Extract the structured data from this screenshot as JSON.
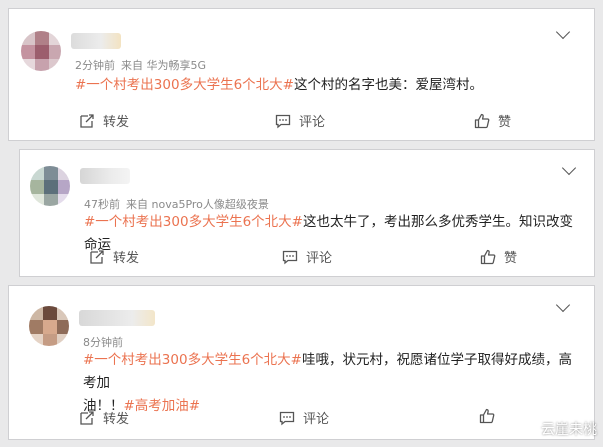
{
  "posts": [
    {
      "time": "2分钟前",
      "source": "来自 华为畅享5G",
      "topic": "#一个村考出300多大学生6个北大#",
      "text": "这个村的名字也美：爱屋湾村。",
      "text2": "",
      "topic2": "",
      "repost_label": "转发",
      "comment_label": "评论",
      "like_label": "赞"
    },
    {
      "time": "47秒前",
      "source": "来自 nova5Pro人像超级夜景",
      "topic": "#一个村考出300多大学生6个北大#",
      "text": "这也太牛了，考出那么多优秀学生。知识改变命运",
      "text2": "",
      "topic2": "",
      "repost_label": "转发",
      "comment_label": "评论",
      "like_label": "赞"
    },
    {
      "time": "8分钟前",
      "source": "",
      "topic": "#一个村考出300多大学生6个北大#",
      "text": "哇哦，状元村，祝愿诸位学子取得好成绩，高考加",
      "text2": "油！！",
      "topic2": "#高考加油#",
      "repost_label": "转发",
      "comment_label": "评论",
      "like_label": ""
    }
  ],
  "watermark": {
    "text": "云崖未桃"
  },
  "icons": {
    "menu": "chevron-down-icon",
    "repost": "repost-icon",
    "comment": "comment-icon",
    "like": "thumbs-up-icon"
  },
  "colors": {
    "topic": "#eb7350",
    "meta": "#8a8a8a",
    "background": "#e9e9ea"
  }
}
